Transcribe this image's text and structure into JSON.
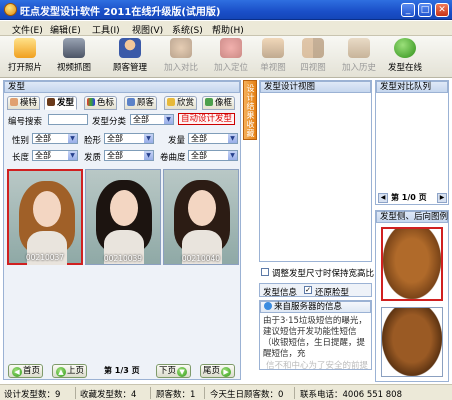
{
  "window": {
    "title": "旺点发型设计软件 2011在线升级版(试用版)",
    "min": "_",
    "max": "□",
    "close": "✕"
  },
  "menu": [
    "文件(E)",
    "编辑(E)",
    "工具(I)",
    "视图(V)",
    "系统(S)",
    "帮助(H)"
  ],
  "toolbar": {
    "open_photo": "打开照片",
    "video_capture": "视频抓图",
    "customer_mgmt": "顾客管理",
    "add_compare": "加入对比",
    "add_locate": "加入定位",
    "single_view": "单视图",
    "four_view": "四视图",
    "add_history": "加入历史",
    "online": "发型在线"
  },
  "left": {
    "header": "发型",
    "tabs": [
      "模特",
      "发型",
      "色标",
      "顾客",
      "欣赏",
      "像框"
    ],
    "search_label": "编号搜索",
    "category_label": "发型分类",
    "category_value": "全部",
    "auto_design": "自动设计发型",
    "filters": {
      "gender": "性别",
      "shape": "脸形",
      "volume": "发量",
      "length": "长度",
      "quality": "发质",
      "curl": "卷曲度",
      "all": "全部"
    },
    "thumbs": [
      "00210037",
      "00210039",
      "00210040"
    ],
    "nav": {
      "first": "首页",
      "prev": "上页",
      "page": "第 1/3 页",
      "next": "下页",
      "last": "尾页"
    }
  },
  "mid_strip": "设计结果收藏",
  "view": {
    "header": "发型设计视图",
    "sync_size": "调整发型尺寸时保持宽高比",
    "quick_select": "发型信息",
    "restore": "还原脸型",
    "info_source": "来自服务器的信息",
    "info_text": "由于3·15垃圾短信的曝光，建议短信开发功能性短信（收银短信，生日提醒，提醒短信，充",
    "watermark_bottom": "信不和中心为了安全的前提"
  },
  "compare": {
    "header": "发型对比队列",
    "page": "第 1/0 页"
  },
  "side": {
    "header": "发型侧、后向图例"
  },
  "status": {
    "designed": "设计发型数：9",
    "saved": "收藏发型数：4",
    "customers": "顾客数：1",
    "today": "今天生日顾客数：0",
    "phone": "联系电话：4006 551 808"
  }
}
